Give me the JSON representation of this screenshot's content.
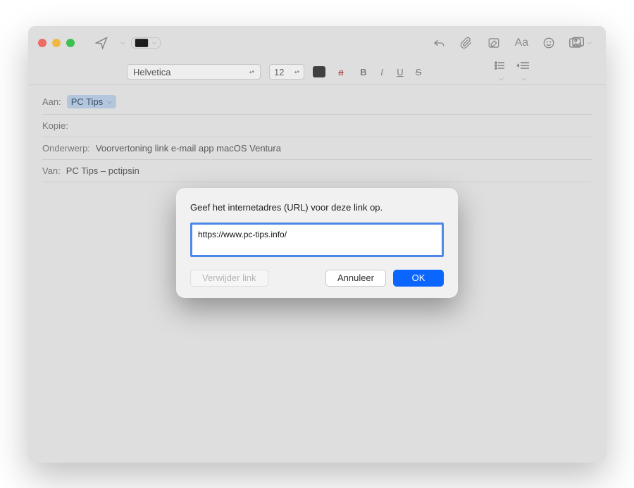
{
  "format": {
    "font": "Helvetica",
    "size": "12"
  },
  "fields": {
    "to_label": "Aan:",
    "to_recipient": "PC Tips",
    "cc_label": "Kopie:",
    "subject_label": "Onderwerp:",
    "subject_value": "Voorvertoning link e-mail app macOS Ventura",
    "from_label": "Van:",
    "from_value": "PC Tips – pctipsin"
  },
  "dialog": {
    "title": "Geef het internetadres (URL) voor deze link op.",
    "url_value": "https://www.pc-tips.info/",
    "remove_label": "Verwijder link",
    "cancel_label": "Annuleer",
    "ok_label": "OK"
  }
}
